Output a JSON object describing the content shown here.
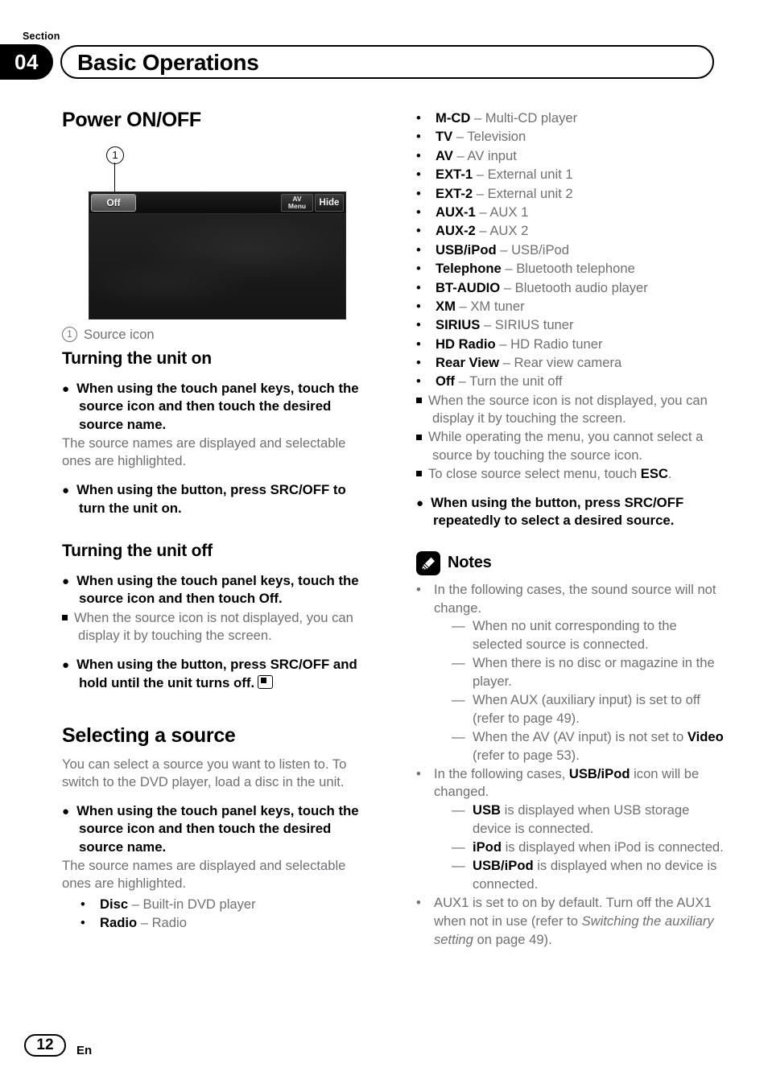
{
  "header": {
    "section_word": "Section",
    "section_number": "04",
    "title": "Basic Operations"
  },
  "left_column": {
    "heading": "Power ON/OFF",
    "figure": {
      "callout_number": "1",
      "device_screen": {
        "source_button": "Off",
        "av_menu_line1": "AV",
        "av_menu_line2": "Menu",
        "hide_button": "Hide"
      },
      "caption_number": "1",
      "caption_text": "Source icon"
    },
    "turning_on": {
      "subhead": "Turning the unit on",
      "item1_bold": "When using the touch panel keys, touch the source icon and then touch the desired source name.",
      "item1_body": "The source names are displayed and selectable ones are highlighted.",
      "item2_bold": "When using the button, press SRC/OFF to turn the unit on."
    },
    "turning_off": {
      "subhead": "Turning the unit off",
      "item1_bold": "When using the touch panel keys, touch the source icon and then touch Off.",
      "item1_note": "When the source icon is not displayed, you can display it by touching the screen.",
      "item2_bold": "When using the button, press SRC/OFF and hold until the unit turns off."
    },
    "selecting": {
      "heading": "Selecting a source",
      "intro": "You can select a source you want to listen to. To switch to the DVD player, load a disc in the unit.",
      "item1_bold": "When using the touch panel keys, touch the source icon and then touch the desired source name.",
      "item1_body": "The source names are displayed and selectable ones are highlighted.",
      "sources": [
        {
          "name": "Disc",
          "desc": "Built-in DVD player"
        },
        {
          "name": "Radio",
          "desc": "Radio"
        }
      ]
    }
  },
  "right_column": {
    "sources": [
      {
        "name": "M-CD",
        "desc": "Multi-CD player"
      },
      {
        "name": "TV",
        "desc": "Television"
      },
      {
        "name": "AV",
        "desc": "AV input"
      },
      {
        "name": "EXT-1",
        "desc": "External unit 1"
      },
      {
        "name": "EXT-2",
        "desc": "External unit 2"
      },
      {
        "name": "AUX-1",
        "desc": "AUX 1"
      },
      {
        "name": "AUX-2",
        "desc": "AUX 2"
      },
      {
        "name": "USB/iPod",
        "desc": "USB/iPod"
      },
      {
        "name": "Telephone",
        "desc": "Bluetooth telephone"
      },
      {
        "name": "BT-AUDIO",
        "desc": "Bluetooth audio player"
      },
      {
        "name": "XM",
        "desc": "XM tuner"
      },
      {
        "name": "SIRIUS",
        "desc": "SIRIUS tuner"
      },
      {
        "name": "HD Radio",
        "desc": "HD Radio tuner"
      },
      {
        "name": "Rear View",
        "desc": "Rear view camera"
      },
      {
        "name": "Off",
        "desc": "Turn the unit off"
      }
    ],
    "note1": "When the source icon is not displayed, you can display it by touching the screen.",
    "note2": "While operating the menu, you cannot select a source by touching the source icon.",
    "note3_pre": "To close source select menu, touch ",
    "note3_key": "ESC",
    "note3_post": ".",
    "item_bold": "When using the button, press SRC/OFF repeatedly to select a desired source.",
    "notes": {
      "icon": "pencil-note-icon",
      "title": "Notes",
      "n1": "In the following cases, the sound source will not change.",
      "n1_sub1": "When no unit corresponding to the selected source is connected.",
      "n1_sub2": "When there is no disc or magazine in the player.",
      "n1_sub3": "When AUX (auxiliary input) is set to off (refer to page 49).",
      "n1_sub4_a": "When the AV (AV input) is not set to ",
      "n1_sub4_k": "Video",
      "n1_sub4_b": " (refer to page 53).",
      "n2_a": "In the following cases, ",
      "n2_k": "USB/iPod",
      "n2_b": " icon will be changed.",
      "n2_sub1_k": "USB",
      "n2_sub1_b": " is displayed when USB storage device is connected.",
      "n2_sub2_k": "iPod",
      "n2_sub2_b": " is displayed when iPod is connected.",
      "n2_sub3_k": "USB/iPod",
      "n2_sub3_b": " is displayed when no device is connected.",
      "n3_a": "AUX1 is set to on by default. Turn off the AUX1 when not in use (refer to ",
      "n3_i": "Switching the auxiliary setting",
      "n3_b": " on page 49)."
    }
  },
  "footer": {
    "page_number": "12",
    "language": "En"
  }
}
